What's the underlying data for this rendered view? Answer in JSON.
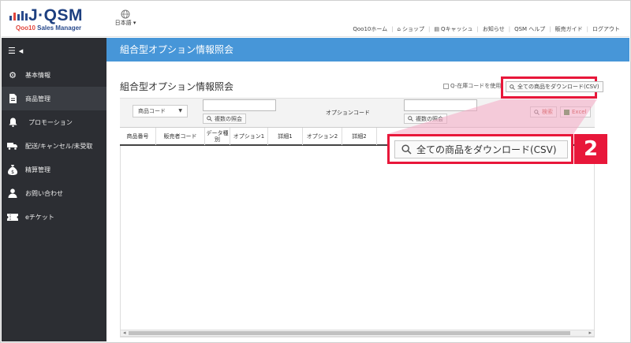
{
  "header": {
    "logo_text": "J·QSM",
    "logo_sub_prefix": "Qoo10",
    "logo_sub_suffix": " Sales Manager",
    "language": "日本語",
    "links": [
      "Qoo10ホーム",
      "ショップ",
      "Qキャッシュ",
      "お知らせ",
      "QSM ヘルプ",
      "販売ガイド",
      "ログアウト"
    ]
  },
  "sidebar": {
    "items": [
      {
        "label": "基本情報",
        "icon": "gears-icon"
      },
      {
        "label": "商品管理",
        "icon": "document-icon"
      },
      {
        "label": "プロモーション",
        "icon": "bell-icon"
      },
      {
        "label": "配送/キャンセル/未受取",
        "icon": "truck-icon"
      },
      {
        "label": "精算管理",
        "icon": "money-bag-icon"
      },
      {
        "label": "お問い合わせ",
        "icon": "person-icon"
      },
      {
        "label": "eチケット",
        "icon": "ticket-icon"
      }
    ]
  },
  "page": {
    "header_title": "組合型オプション情報照会",
    "content_title": "組合型オプション情報照会",
    "stock_code_checkbox_label": "Q-在庫コードを使用",
    "download_all_label": "全ての商品をダウンロード(CSV)",
    "product_code_select": "商品コード",
    "multi_search_label": "複数の照会",
    "option_code_label": "オプションコード",
    "search_label": "検索",
    "excel_label": "Excel"
  },
  "table": {
    "columns": [
      "商品番号",
      "販売者コード",
      "データ種別",
      "オプション1",
      "詳細1",
      "オプション2",
      "詳細2"
    ]
  },
  "callout": {
    "button_label": "全ての商品をダウンロード(CSV)",
    "step_number": "2"
  },
  "colors": {
    "sidebar_bg": "#2c2e33",
    "header_blue": "#4796d8",
    "highlight_red": "#e8173a"
  }
}
